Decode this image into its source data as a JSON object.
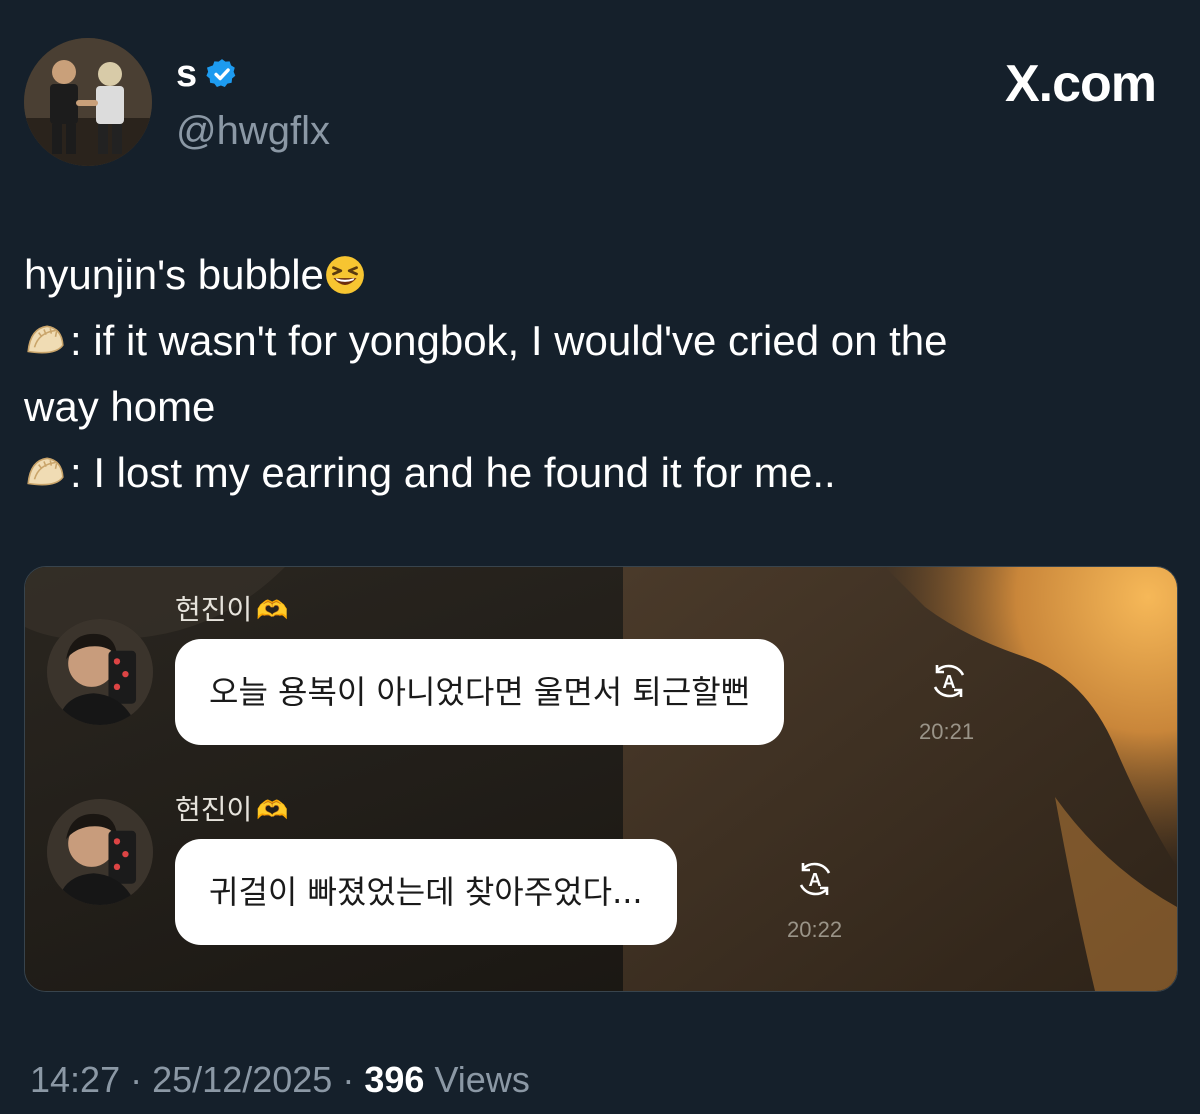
{
  "author": {
    "display_name": "s",
    "handle": "@hwgflx",
    "verified": true
  },
  "brand": "X.com",
  "tweet": {
    "line1": "hyunjin's bubble",
    "line1_emoji": "laughing-squinting-face",
    "line2_emoji": "dumpling",
    "line2": ": if it wasn't for yongbok, I would've cried on the",
    "line3": "way home",
    "line4_emoji": "dumpling",
    "line4": ": I lost my earring and he found it for me.."
  },
  "media": {
    "messages": [
      {
        "sender": "현진이",
        "sender_emoji": "heart-hands",
        "text": "오늘 용복이 아니었다면 울면서 퇴근할뻔",
        "time": "20:21",
        "icon": "translate-icon"
      },
      {
        "sender": "현진이",
        "sender_emoji": "heart-hands",
        "text": "귀걸이 빠졌었는데 찾아주었다...",
        "time": "20:22",
        "icon": "translate-icon"
      }
    ]
  },
  "meta": {
    "time": "14:27",
    "separator": "·",
    "date": "25/12/2025",
    "views_count": "396",
    "views_label": "Views"
  },
  "colors": {
    "background": "#15202b",
    "secondary_text": "#8b98a5",
    "verified_blue": "#1d9bf0"
  }
}
